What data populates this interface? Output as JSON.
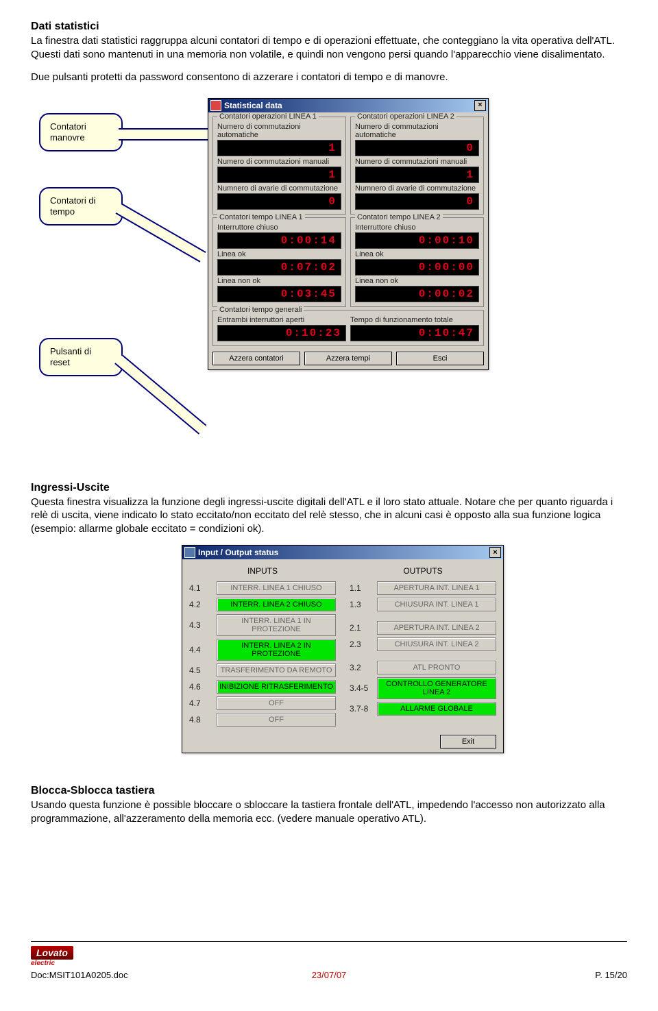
{
  "section1": {
    "title": "Dati statistici",
    "p1": "La finestra dati statistici raggruppa alcuni contatori di tempo e di operazioni effettuate, che conteggiano la vita operativa dell'ATL. Questi dati sono mantenuti in una memoria non volatile, e quindi non vengono persi quando l'apparecchio viene disalimentato.",
    "p2": "Due pulsanti protetti da password consentono di azzerare i contatori di tempo e di manovre."
  },
  "callouts": {
    "c1": "Contatori manovre",
    "c2": "Contatori di tempo",
    "c3": "Pulsanti di reset"
  },
  "statDialog": {
    "title": "Statistical data",
    "g1": {
      "title": "Contatori operazioni LINEA 1",
      "l1": "Numero di commutazioni automatiche",
      "v1": "1",
      "l2": "Numero di commutazioni manuali",
      "v2": "1",
      "l3": "Numnero di avarie di commutazione",
      "v3": "0"
    },
    "g2": {
      "title": "Contatori operazioni LINEA 2",
      "l1": "Numero di commutazioni automatiche",
      "v1": "0",
      "l2": "Numero di commutazioni manuali",
      "v2": "1",
      "l3": "Numnero di avarie di commutazione",
      "v3": "0"
    },
    "g3": {
      "title": "Contatori tempo LINEA 1",
      "l1": "Interruttore chiuso",
      "v1": "0:00:14",
      "l2": "Linea ok",
      "v2": "0:07:02",
      "l3": "Linea non ok",
      "v3": "0:03:45"
    },
    "g4": {
      "title": "Contatori tempo LINEA 2",
      "l1": "Interruttore chiuso",
      "v1": "0:00:10",
      "l2": "Linea ok",
      "v2": "0:00:00",
      "l3": "Linea non ok",
      "v3": "0:00:02"
    },
    "g5": {
      "title": "Contatori tempo generali",
      "l1": "Entrambi interruttori aperti",
      "v1": "0:10:23",
      "l2": "Tempo di funzionamento totale",
      "v2": "0:10:47"
    },
    "btn_reset_counters": "Azzera contatori",
    "btn_reset_times": "Azzera tempi",
    "btn_exit": "Esci"
  },
  "section2": {
    "title": "Ingressi-Uscite",
    "p": "Questa finestra visualizza la funzione degli ingressi-uscite digitali dell'ATL e il loro stato attuale. Notare che per quanto riguarda i relè di uscita, viene indicato lo stato eccitato/non eccitato del relè stesso, che in alcuni casi è opposto alla sua funzione logica (esempio: allarme globale eccitato = condizioni ok)."
  },
  "ioDialog": {
    "title": "Input / Output status",
    "inputs_title": "INPUTS",
    "outputs_title": "OUTPUTS",
    "inputs": [
      {
        "idx": "4.1",
        "label": "INTERR. LINEA 1 CHIUSO",
        "on": false
      },
      {
        "idx": "4.2",
        "label": "INTERR. LINEA 2 CHIUSO",
        "on": true
      },
      {
        "idx": "4.3",
        "label": "INTERR. LINEA 1 IN PROTEZIONE",
        "on": false
      },
      {
        "idx": "4.4",
        "label": "INTERR. LINEA 2 IN PROTEZIONE",
        "on": true
      },
      {
        "idx": "4.5",
        "label": "TRASFERIMENTO DA REMOTO",
        "on": false
      },
      {
        "idx": "4.6",
        "label": "INIBIZIONE RITRASFERIMENTO",
        "on": true
      },
      {
        "idx": "4.7",
        "label": "OFF",
        "on": false
      },
      {
        "idx": "4.8",
        "label": "OFF",
        "on": false
      }
    ],
    "outputs": [
      {
        "idx": "1.1",
        "label": "APERTURA INT. LINEA 1",
        "on": false
      },
      {
        "idx": "1.3",
        "label": "CHIUSURA INT. LINEA 1",
        "on": false
      },
      {
        "idx": "2.1",
        "label": "APERTURA INT. LINEA 2",
        "on": false
      },
      {
        "idx": "2.3",
        "label": "CHIUSURA INT. LINEA 2",
        "on": false
      },
      {
        "idx": "3.2",
        "label": "ATL PRONTO",
        "on": false
      },
      {
        "idx": "3.4-5",
        "label": "CONTROLLO GENERATORE LINEA 2",
        "on": true
      },
      {
        "idx": "3.7-8",
        "label": "ALLARME GLOBALE",
        "on": true
      }
    ],
    "btn_exit": "Exit"
  },
  "section3": {
    "title": "Blocca-Sblocca tastiera",
    "p": "Usando questa funzione è possible bloccare o sbloccare la tastiera frontale dell'ATL, impedendo l'accesso non autorizzato alla programmazione, all'azzeramento della memoria ecc. (vedere manuale operativo ATL)."
  },
  "footer": {
    "logo": "Lovato",
    "logo_sub": "electric",
    "doc": "Doc:MSIT101A0205.doc",
    "date": "23/07/07",
    "page": "P. 15/20"
  }
}
